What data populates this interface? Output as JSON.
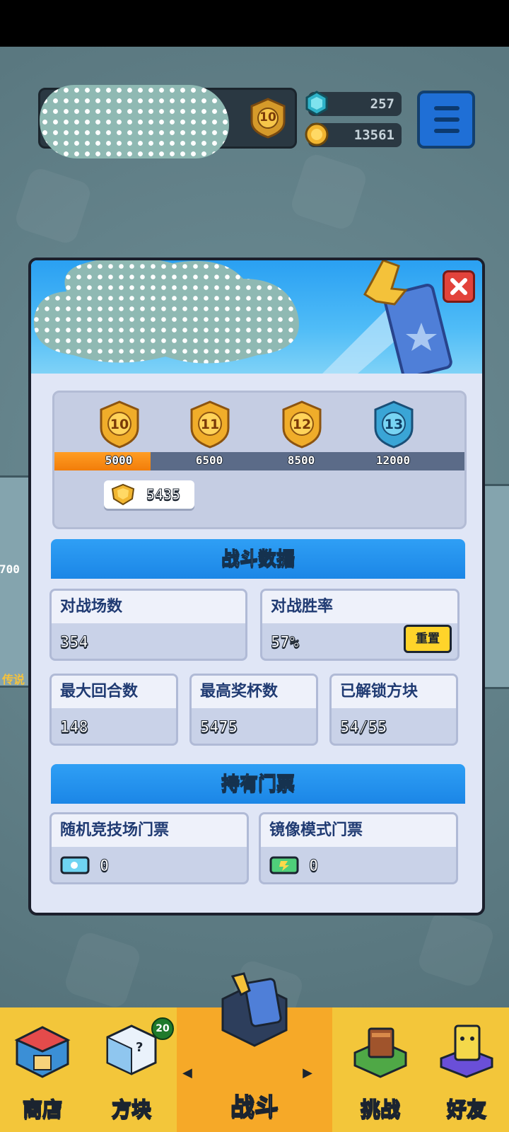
{
  "hud": {
    "rank_level": "10",
    "gems": "257",
    "coins": "13561"
  },
  "panel": {
    "ranks": [
      {
        "level": "10",
        "threshold": "5000"
      },
      {
        "level": "11",
        "threshold": "6500"
      },
      {
        "level": "12",
        "threshold": "8500"
      },
      {
        "level": "13",
        "threshold": "12000"
      }
    ],
    "rank_progress_fraction": 0.235,
    "trophies": "5435",
    "battle_stats": {
      "title": "战斗数据",
      "matches_label": "对战场数",
      "matches_value": "354",
      "win_rate_label": "对战胜率",
      "win_rate_value": "57%",
      "reset_label": "重置",
      "max_rounds_label": "最大回合数",
      "max_rounds_value": "148",
      "max_trophies_label": "最高奖杯数",
      "max_trophies_value": "5475",
      "unlocked_blocks_label": "已解锁方块",
      "unlocked_blocks_value": "54/55"
    },
    "tickets": {
      "title": "持有门票",
      "random_arena_label": "随机竞技场门票",
      "random_arena_value": "0",
      "mirror_mode_label": "镜像模式门票",
      "mirror_mode_value": "0"
    }
  },
  "background": {
    "side_number": "700",
    "side_label": "传说"
  },
  "nav": {
    "shop": "商店",
    "blocks": "方块",
    "blocks_badge": "20",
    "battle": "战斗",
    "challenge": "挑战",
    "friends": "好友",
    "left_arrow": "◀",
    "right_arrow": "▶"
  },
  "colors": {
    "accent_blue": "#1b86e6",
    "progress_orange": "#f27d0a",
    "nav_yellow": "#f3c63a",
    "close_red": "#e2433b"
  }
}
